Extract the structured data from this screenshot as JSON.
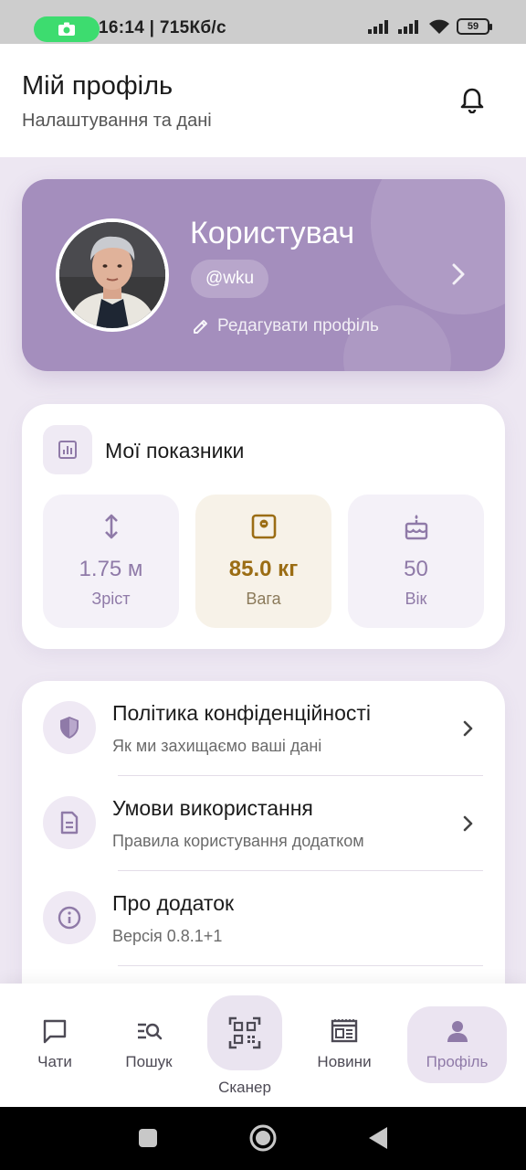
{
  "status_bar": {
    "time_info": "16:14 | 715Кб/с",
    "battery": "59",
    "icons": [
      "camera-icon",
      "signal-icon",
      "signal-icon",
      "wifi-icon",
      "battery-icon"
    ]
  },
  "header": {
    "title": "Мій профіль",
    "subtitle": "Налаштування та дані",
    "icon": "bell-icon"
  },
  "profile": {
    "name": "Користувач",
    "handle": "@wku",
    "edit_label": "Редагувати профіль"
  },
  "metrics": {
    "title": "Мої показники",
    "items": [
      {
        "value": "1.75 м",
        "label": "Зріст",
        "icon": "height-icon"
      },
      {
        "value": "85.0 кг",
        "label": "Вага",
        "icon": "scale-icon"
      },
      {
        "value": "50",
        "label": "Вік",
        "icon": "cake-icon"
      }
    ]
  },
  "settings": [
    {
      "title": "Політика конфіденційності",
      "subtitle": "Як ми захищаємо ваші дані",
      "icon": "shield-icon"
    },
    {
      "title": "Умови використання",
      "subtitle": "Правила користування додатком",
      "icon": "document-icon"
    },
    {
      "title": "Про додаток",
      "subtitle": "Версія 0.8.1+1",
      "icon": "info-icon"
    }
  ],
  "nav": {
    "items": [
      {
        "label": "Чати",
        "icon": "chat-icon"
      },
      {
        "label": "Пошук",
        "icon": "search-icon"
      },
      {
        "label": "Сканер",
        "icon": "qr-scanner-icon"
      },
      {
        "label": "Новини",
        "icon": "news-icon"
      },
      {
        "label": "Профіль",
        "icon": "person-icon",
        "active": true
      }
    ]
  },
  "colors": {
    "accent": "#a48ebd",
    "accent_text": "#8f7aa8",
    "weight_highlight": "#9b6d14",
    "background": "#ede7f2"
  }
}
